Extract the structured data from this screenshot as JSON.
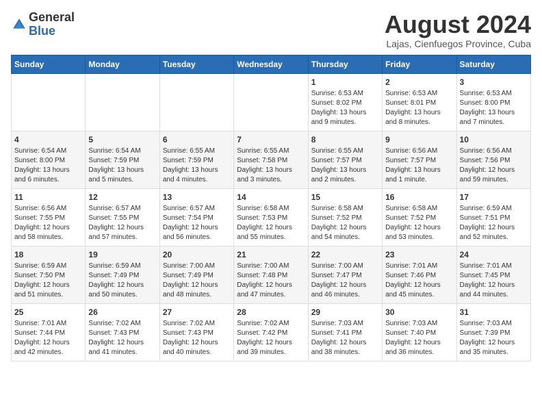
{
  "header": {
    "logo_general": "General",
    "logo_blue": "Blue",
    "month_year": "August 2024",
    "location": "Lajas, Cienfuegos Province, Cuba"
  },
  "days_of_week": [
    "Sunday",
    "Monday",
    "Tuesday",
    "Wednesday",
    "Thursday",
    "Friday",
    "Saturday"
  ],
  "weeks": [
    [
      {
        "day": "",
        "info": ""
      },
      {
        "day": "",
        "info": ""
      },
      {
        "day": "",
        "info": ""
      },
      {
        "day": "",
        "info": ""
      },
      {
        "day": "1",
        "info": "Sunrise: 6:53 AM\nSunset: 8:02 PM\nDaylight: 13 hours\nand 9 minutes."
      },
      {
        "day": "2",
        "info": "Sunrise: 6:53 AM\nSunset: 8:01 PM\nDaylight: 13 hours\nand 8 minutes."
      },
      {
        "day": "3",
        "info": "Sunrise: 6:53 AM\nSunset: 8:00 PM\nDaylight: 13 hours\nand 7 minutes."
      }
    ],
    [
      {
        "day": "4",
        "info": "Sunrise: 6:54 AM\nSunset: 8:00 PM\nDaylight: 13 hours\nand 6 minutes."
      },
      {
        "day": "5",
        "info": "Sunrise: 6:54 AM\nSunset: 7:59 PM\nDaylight: 13 hours\nand 5 minutes."
      },
      {
        "day": "6",
        "info": "Sunrise: 6:55 AM\nSunset: 7:59 PM\nDaylight: 13 hours\nand 4 minutes."
      },
      {
        "day": "7",
        "info": "Sunrise: 6:55 AM\nSunset: 7:58 PM\nDaylight: 13 hours\nand 3 minutes."
      },
      {
        "day": "8",
        "info": "Sunrise: 6:55 AM\nSunset: 7:57 PM\nDaylight: 13 hours\nand 2 minutes."
      },
      {
        "day": "9",
        "info": "Sunrise: 6:56 AM\nSunset: 7:57 PM\nDaylight: 13 hours\nand 1 minute."
      },
      {
        "day": "10",
        "info": "Sunrise: 6:56 AM\nSunset: 7:56 PM\nDaylight: 12 hours\nand 59 minutes."
      }
    ],
    [
      {
        "day": "11",
        "info": "Sunrise: 6:56 AM\nSunset: 7:55 PM\nDaylight: 12 hours\nand 58 minutes."
      },
      {
        "day": "12",
        "info": "Sunrise: 6:57 AM\nSunset: 7:55 PM\nDaylight: 12 hours\nand 57 minutes."
      },
      {
        "day": "13",
        "info": "Sunrise: 6:57 AM\nSunset: 7:54 PM\nDaylight: 12 hours\nand 56 minutes."
      },
      {
        "day": "14",
        "info": "Sunrise: 6:58 AM\nSunset: 7:53 PM\nDaylight: 12 hours\nand 55 minutes."
      },
      {
        "day": "15",
        "info": "Sunrise: 6:58 AM\nSunset: 7:52 PM\nDaylight: 12 hours\nand 54 minutes."
      },
      {
        "day": "16",
        "info": "Sunrise: 6:58 AM\nSunset: 7:52 PM\nDaylight: 12 hours\nand 53 minutes."
      },
      {
        "day": "17",
        "info": "Sunrise: 6:59 AM\nSunset: 7:51 PM\nDaylight: 12 hours\nand 52 minutes."
      }
    ],
    [
      {
        "day": "18",
        "info": "Sunrise: 6:59 AM\nSunset: 7:50 PM\nDaylight: 12 hours\nand 51 minutes."
      },
      {
        "day": "19",
        "info": "Sunrise: 6:59 AM\nSunset: 7:49 PM\nDaylight: 12 hours\nand 50 minutes."
      },
      {
        "day": "20",
        "info": "Sunrise: 7:00 AM\nSunset: 7:49 PM\nDaylight: 12 hours\nand 48 minutes."
      },
      {
        "day": "21",
        "info": "Sunrise: 7:00 AM\nSunset: 7:48 PM\nDaylight: 12 hours\nand 47 minutes."
      },
      {
        "day": "22",
        "info": "Sunrise: 7:00 AM\nSunset: 7:47 PM\nDaylight: 12 hours\nand 46 minutes."
      },
      {
        "day": "23",
        "info": "Sunrise: 7:01 AM\nSunset: 7:46 PM\nDaylight: 12 hours\nand 45 minutes."
      },
      {
        "day": "24",
        "info": "Sunrise: 7:01 AM\nSunset: 7:45 PM\nDaylight: 12 hours\nand 44 minutes."
      }
    ],
    [
      {
        "day": "25",
        "info": "Sunrise: 7:01 AM\nSunset: 7:44 PM\nDaylight: 12 hours\nand 42 minutes."
      },
      {
        "day": "26",
        "info": "Sunrise: 7:02 AM\nSunset: 7:43 PM\nDaylight: 12 hours\nand 41 minutes."
      },
      {
        "day": "27",
        "info": "Sunrise: 7:02 AM\nSunset: 7:43 PM\nDaylight: 12 hours\nand 40 minutes."
      },
      {
        "day": "28",
        "info": "Sunrise: 7:02 AM\nSunset: 7:42 PM\nDaylight: 12 hours\nand 39 minutes."
      },
      {
        "day": "29",
        "info": "Sunrise: 7:03 AM\nSunset: 7:41 PM\nDaylight: 12 hours\nand 38 minutes."
      },
      {
        "day": "30",
        "info": "Sunrise: 7:03 AM\nSunset: 7:40 PM\nDaylight: 12 hours\nand 36 minutes."
      },
      {
        "day": "31",
        "info": "Sunrise: 7:03 AM\nSunset: 7:39 PM\nDaylight: 12 hours\nand 35 minutes."
      }
    ]
  ]
}
